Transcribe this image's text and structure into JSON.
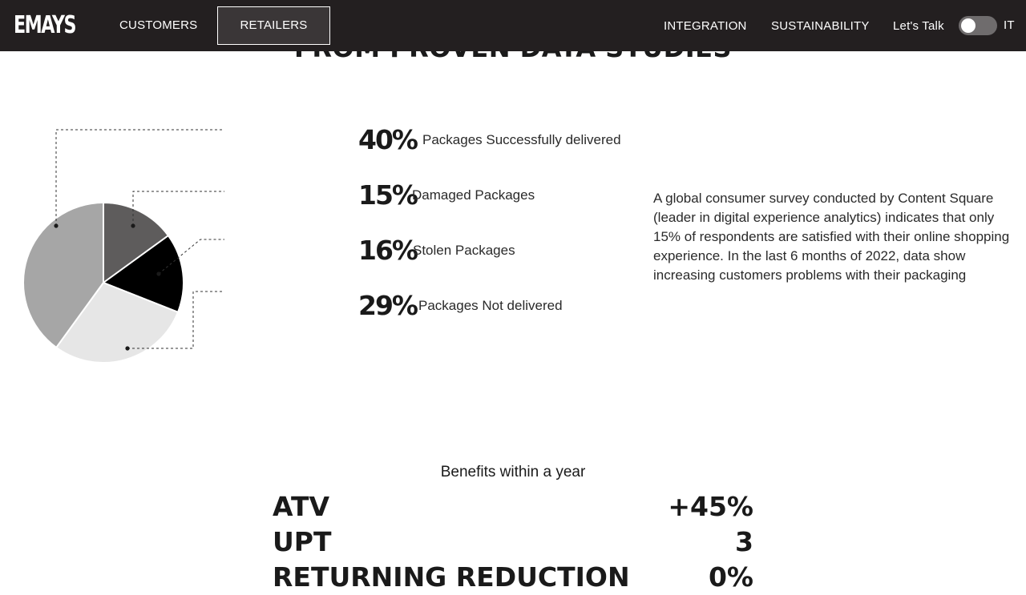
{
  "nav": {
    "logo": "EMAYS",
    "customers": "CUSTOMERS",
    "retailers": "RETAILERS",
    "integration": "INTEGRATION",
    "sustainability": "SUSTAINABILITY",
    "lets_talk": "Let's Talk",
    "language": "IT",
    "toggle_on": false
  },
  "section": {
    "heading": "FROM PROVEN DATA STUDIES"
  },
  "chart_data": {
    "type": "pie",
    "slices": [
      {
        "label": "Packages Successfully delivered",
        "value": 40,
        "color": "#a6a6a6"
      },
      {
        "label": "Damaged Packages",
        "value": 15,
        "color": "#5e5c5c"
      },
      {
        "label": "Stolen Packages",
        "value": 16,
        "color": "#000000"
      },
      {
        "label": "Packages Not delivered",
        "value": 29,
        "color": "#e6e6e6"
      }
    ]
  },
  "stats": [
    {
      "pct": "40%",
      "label": "Packages Successfully delivered"
    },
    {
      "pct": "15%",
      "label": "Damaged Packages"
    },
    {
      "pct": "16%",
      "label": "Stolen Packages"
    },
    {
      "pct": "29%",
      "label": "Packages Not delivered"
    }
  ],
  "description": "A global consumer survey conducted by Content Square (leader in digital experience analytics) indicates that only 15% of respondents are satisfied with their online shopping experience. In the last 6 months of 2022, data show increasing customers problems with their packaging",
  "benefits": {
    "title": "Benefits within a year",
    "rows": [
      {
        "key": "ATV",
        "value": "+45%"
      },
      {
        "key": "UPT",
        "value": "3"
      },
      {
        "key": "RETURNING REDUCTION",
        "value": "0%"
      }
    ]
  }
}
